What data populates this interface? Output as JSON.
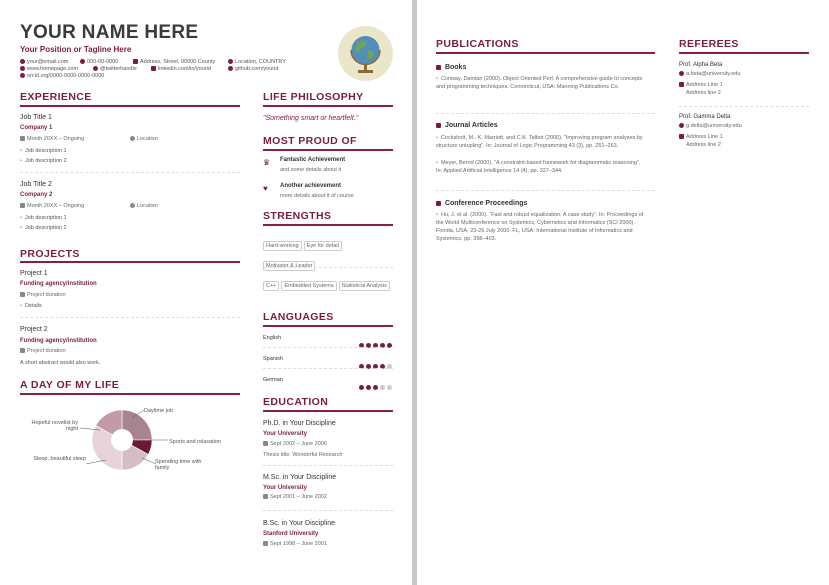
{
  "header": {
    "name": "YOUR NAME HERE",
    "tagline": "Your Position or Tagline Here",
    "contacts": [
      {
        "icon": "email-icon",
        "text": "your@email.com"
      },
      {
        "icon": "phone-icon",
        "text": "000-00-0000"
      },
      {
        "icon": "mail-icon",
        "text": "Address, Street, 00000 County"
      },
      {
        "icon": "location-icon",
        "text": "Location, COUNTRY"
      },
      {
        "icon": "link-icon",
        "text": "www.homepage.com"
      },
      {
        "icon": "twitter-icon",
        "text": "@twitterhandle"
      },
      {
        "icon": "linkedin-icon",
        "text": "linkedin.com/in/yourid"
      },
      {
        "icon": "github-icon",
        "text": "github.com/yourid"
      },
      {
        "icon": "orcid-icon",
        "text": "orcid.org/0000-0000-0000-0000"
      }
    ],
    "photo_icon": "globe-icon"
  },
  "experience": {
    "title": "EXPERIENCE",
    "jobs": [
      {
        "title": "Job Title 1",
        "company": "Company 1",
        "dates": "Month 20XX – Ongoing",
        "location": "Location",
        "items": [
          "Job description 1",
          "Job description 2"
        ]
      },
      {
        "title": "Job Title 2",
        "company": "Company 2",
        "dates": "Month 20XX – Ongoing",
        "location": "Location",
        "items": [
          "Job description 1",
          "Job description 2"
        ]
      }
    ]
  },
  "projects": {
    "title": "PROJECTS",
    "items": [
      {
        "title": "Project 1",
        "funding": "Funding agency/institution",
        "duration": "Project duration",
        "detail": "Details"
      },
      {
        "title": "Project 2",
        "funding": "Funding agency/institution",
        "duration": "Project duration",
        "detail": "A short abstract would also work."
      }
    ]
  },
  "day": {
    "title": "A DAY OF MY LIFE",
    "labels": [
      "Daytime job",
      "Sports and relaxation",
      "Spending time with family",
      "Sleep, beautiful sleep",
      "Hopeful novelist by night"
    ]
  },
  "chart_data": {
    "type": "pie",
    "title": "A DAY OF MY LIFE",
    "slices": [
      {
        "label": "Daytime job",
        "value": 25,
        "color": "#a8848e"
      },
      {
        "label": "Sports and relaxation",
        "value": 8,
        "color": "#6a1a33"
      },
      {
        "label": "Spending time with family",
        "value": 17,
        "color": "#d6bcc4"
      },
      {
        "label": "Sleep, beautiful sleep",
        "value": 33,
        "color": "#e6d4d9"
      },
      {
        "label": "Hopeful novelist by night",
        "value": 17,
        "color": "#c49aa6"
      }
    ]
  },
  "philosophy": {
    "title": "LIFE PHILOSOPHY",
    "quote": "\"Something smart or heartfelt.\""
  },
  "proud": {
    "title": "MOST PROUD OF",
    "items": [
      {
        "icon": "trophy-icon",
        "head": "Fantastic Achievement",
        "text": "and some details about it"
      },
      {
        "icon": "heartbeat-icon",
        "head": "Another achievement",
        "text": "more details about it of course"
      }
    ]
  },
  "strengths": {
    "title": "STRENGTHS",
    "soft": [
      "Hard-working",
      "Eye for detail",
      "Motivator & Leader"
    ],
    "tech": [
      "C++",
      "Embedded Systems",
      "Statistical Analysis"
    ]
  },
  "languages": {
    "title": "LANGUAGES",
    "items": [
      {
        "name": "English",
        "level": 5
      },
      {
        "name": "Spanish",
        "level": 4
      },
      {
        "name": "German",
        "level": 3
      }
    ]
  },
  "education": {
    "title": "EDUCATION",
    "items": [
      {
        "degree": "Ph.D. in Your Discipline",
        "school": "Your University",
        "dates": "Sept 2002 – June 2006",
        "note": "Thesis title: Wonderful Research"
      },
      {
        "degree": "M.Sc. in Your Discipline",
        "school": "Your University",
        "dates": "Sept 2001 – June 2002",
        "note": ""
      },
      {
        "degree": "B.Sc. in Your Discipline",
        "school": "Stanford University",
        "dates": "Sept 1998 – June 2001",
        "note": ""
      }
    ]
  },
  "publications": {
    "title": "PUBLICATIONS",
    "books_h": "Books",
    "books": [
      "Conway, Damian (2000). Object Oriented Perl: A comprehensive guide to concepts and programming techniques. Connecticut, USA: Manning Publications Co."
    ],
    "journals_h": "Journal Articles",
    "journals": [
      "Cockshott, M., K. Marriott, and C.K. Talbot (2000). “Improving program analyses by structure untupling”. In: Journal of Logic Programming 43 (3), pp. 251–263.",
      "Meyer, Bernd (2000). “A constraint-based framework for diagrammatic reasoning”. In: Applied Artificial Intelligence 14 (4), pp. 327–344."
    ],
    "conf_h": "Conference Proceedings",
    "conf": [
      "Hu, J. et al. (2000). “Fast and robust equalization: A case study”. In: Proceedings of the World Multiconference on Systemics, Cybernetics and Informatics (SCI 2000). Florida, USA, 23-26 July 2000. FL, USA: International Institute of Informatics and Systemics, pp. 398–403."
    ]
  },
  "referees": {
    "title": "REFEREES",
    "items": [
      {
        "name": "Prof. Alpha Beta",
        "email": "a.beta@university.edu",
        "addr1": "Address Line 1",
        "addr2": "Address line 2"
      },
      {
        "name": "Prof. Gamma Delta",
        "email": "g.delta@university.edu",
        "addr1": "Address Line 1",
        "addr2": "Address line 2"
      }
    ]
  }
}
